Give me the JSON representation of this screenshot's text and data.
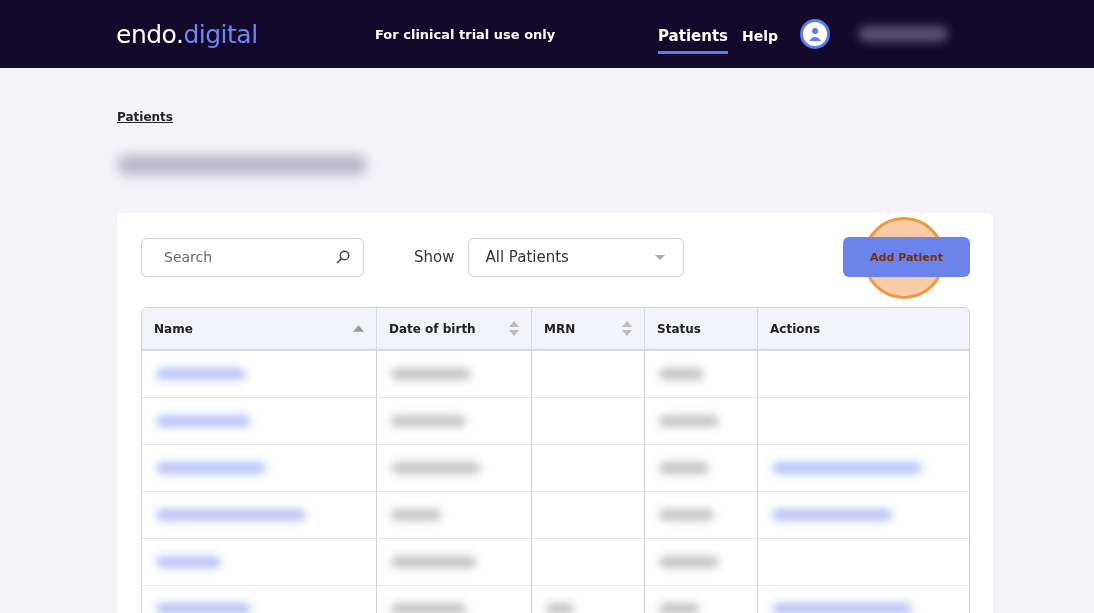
{
  "header": {
    "logo": {
      "part_1": "endo.",
      "part_2": "digital"
    },
    "notice": "For clinical trial use only",
    "nav": [
      {
        "label": "Patients",
        "selected": true
      },
      {
        "label": "Help",
        "selected": false
      }
    ],
    "user": {
      "name_redacted": true
    }
  },
  "breadcrumb": "Patients",
  "page_title": {
    "redacted": true
  },
  "toolbar": {
    "search": {
      "placeholder": "Search"
    },
    "show_label": "Show",
    "filter": {
      "value": "All Patients"
    },
    "add_button": {
      "label": "Add Patient",
      "highlighted": true
    }
  },
  "table": {
    "columns": [
      {
        "label": "Name",
        "sortable": true,
        "sorted": true
      },
      {
        "label": "Date of birth",
        "sortable": true,
        "sorted": false
      },
      {
        "label": "MRN",
        "sortable": true,
        "sorted": false
      },
      {
        "label": "Status"
      },
      {
        "label": "Actions"
      }
    ],
    "rows": [
      {
        "cells": [
          {
            "redacted": true
          },
          {
            "redacted": true
          },
          {
            "redacted": false
          },
          {
            "redacted": true
          },
          {
            "redacted": false
          }
        ]
      },
      {
        "cells": [
          {
            "redacted": true
          },
          {
            "redacted": true
          },
          {
            "redacted": false
          },
          {
            "redacted": true
          },
          {
            "redacted": false
          }
        ]
      },
      {
        "cells": [
          {
            "redacted": true
          },
          {
            "redacted": true
          },
          {
            "redacted": false
          },
          {
            "redacted": true
          },
          {
            "redacted": true
          }
        ]
      },
      {
        "cells": [
          {
            "redacted": true
          },
          {
            "redacted": true
          },
          {
            "redacted": false
          },
          {
            "redacted": true
          },
          {
            "redacted": true
          }
        ]
      },
      {
        "cells": [
          {
            "redacted": true
          },
          {
            "redacted": true
          },
          {
            "redacted": false
          },
          {
            "redacted": true
          },
          {
            "redacted": false
          }
        ]
      },
      {
        "cells": [
          {
            "redacted": true
          },
          {
            "redacted": true
          },
          {
            "redacted": true
          },
          {
            "redacted": true
          },
          {
            "redacted": true
          }
        ]
      }
    ]
  }
}
